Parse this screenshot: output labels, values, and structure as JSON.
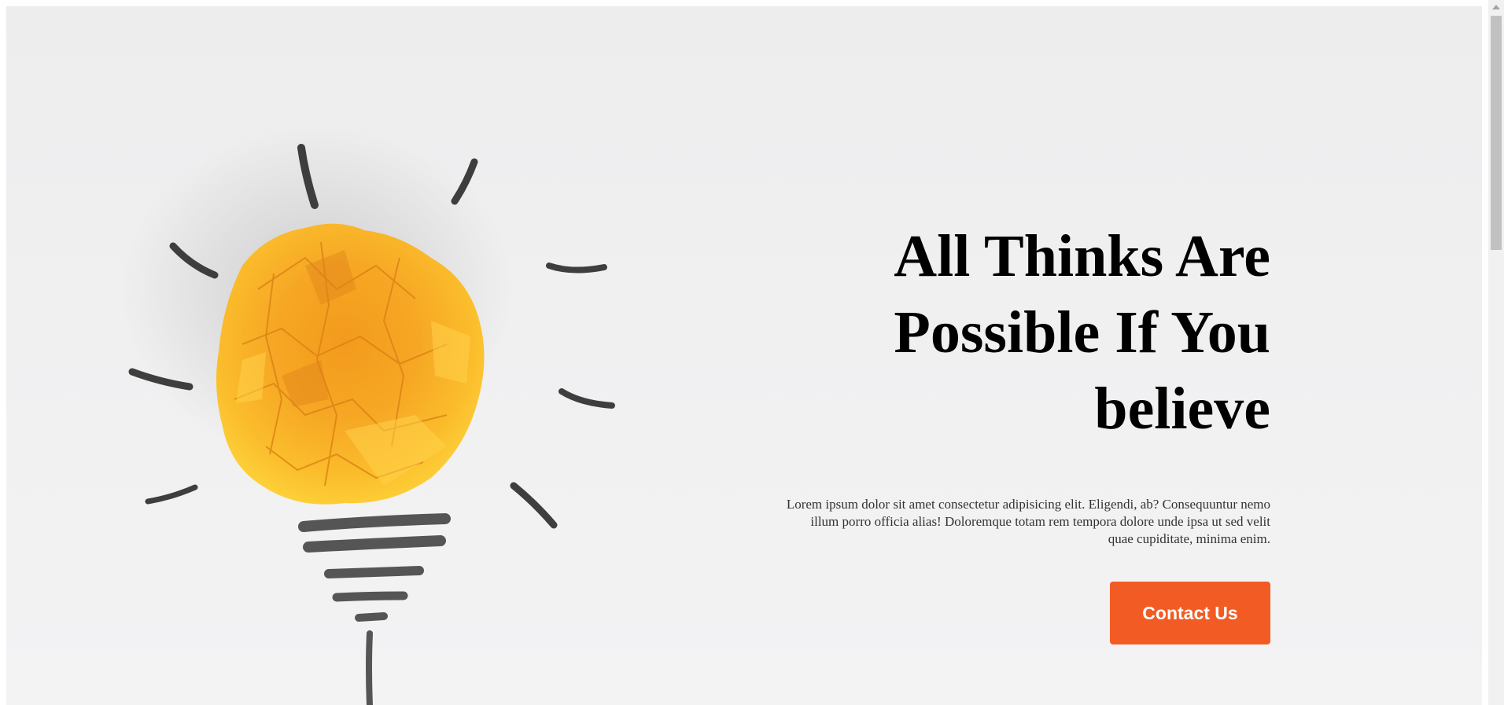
{
  "hero": {
    "title": "All Thinks Are Possible If You believe",
    "text": "Lorem ipsum dolor sit amet consectetur adipisicing elit. Eligendi, ab? Consequuntur nemo illum porro officia alias! Doloremque totam rem tempora dolore unde ipsa ut sed velit quae cupiditate, minima enim.",
    "button_label": "Contact Us",
    "illustration": "crumpled-paper-lightbulb",
    "accent_color": "#f25c24"
  }
}
